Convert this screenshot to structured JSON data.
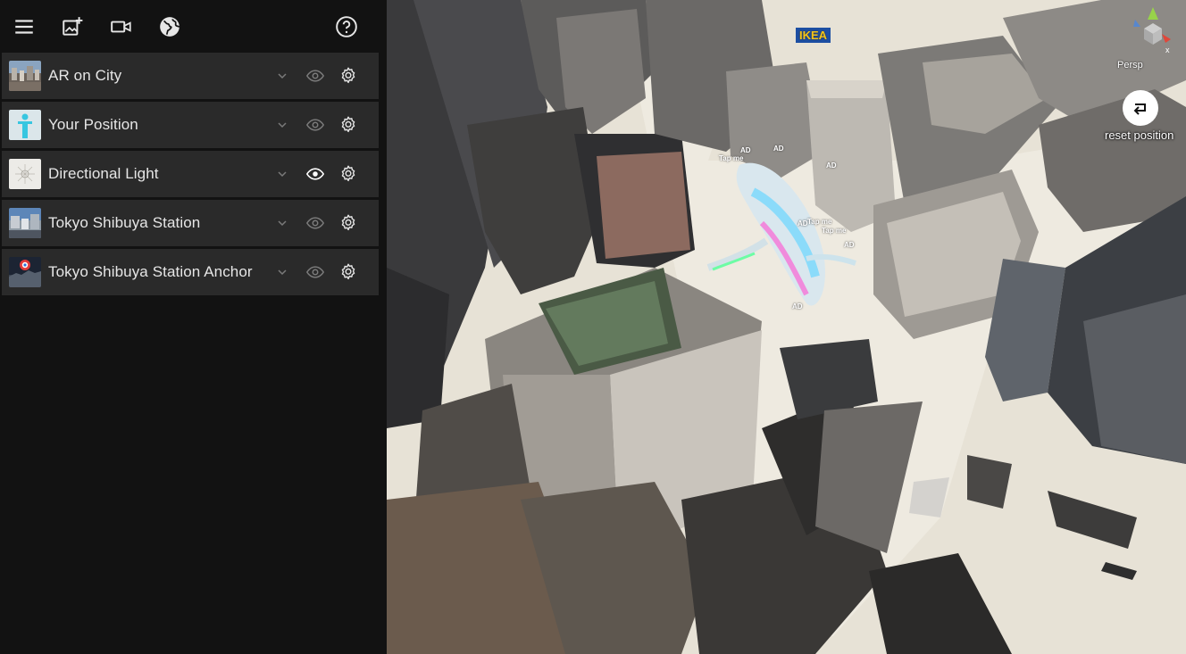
{
  "toolbar": {
    "icons": [
      "menu-icon",
      "add-image-icon",
      "video-camera-icon",
      "globe-icon",
      "help-icon"
    ]
  },
  "layers": [
    {
      "label": "AR on City",
      "thumb": "city-photo",
      "visible": false
    },
    {
      "label": "Your Position",
      "thumb": "person-figure",
      "visible": false
    },
    {
      "label": "Directional Light",
      "thumb": "light-grid",
      "visible": true
    },
    {
      "label": "Tokyo Shibuya Station",
      "thumb": "station-photo",
      "visible": false
    },
    {
      "label": "Tokyo Shibuya Station Anchor",
      "thumb": "anchor-pin",
      "visible": false
    }
  ],
  "viewport": {
    "projection_label": "Persp",
    "reset_label": "reset position",
    "ad_tags": [
      "AD",
      "AD",
      "AD",
      "AD",
      "AD",
      "AD"
    ],
    "tap_tags": [
      "Tap me",
      "Tap me",
      "Tap me"
    ],
    "billboard": "IKEA"
  },
  "colors": {
    "panel_bg": "#121212",
    "row_bg": "#2a2a2a",
    "text": "#e6e6e6",
    "icon_dim": "#7a7a7a",
    "icon_bright": "#ffffff",
    "ground": "#e7e2d6"
  }
}
